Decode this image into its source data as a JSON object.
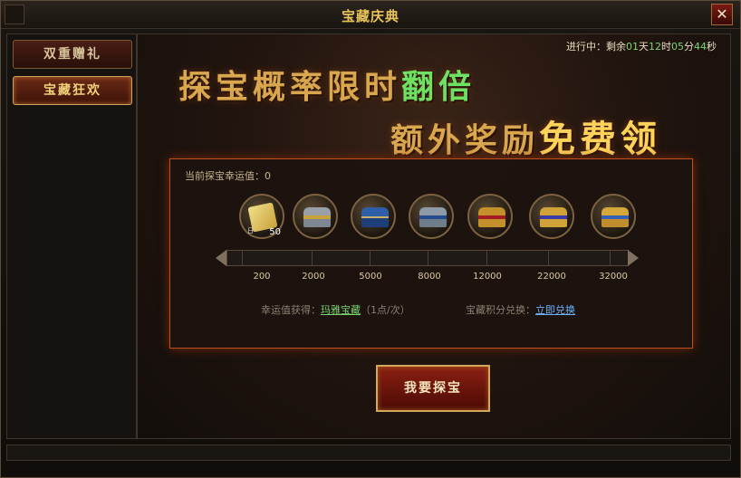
{
  "window": {
    "title": "宝藏庆典",
    "close_label": "✕"
  },
  "sidebar": {
    "tabs": [
      {
        "label": "双重赠礼",
        "active": false
      },
      {
        "label": "宝藏狂欢",
        "active": true
      }
    ]
  },
  "countdown": {
    "prefix": "进行中：剩余",
    "days": "01",
    "day_unit": "天",
    "hours": "12",
    "hour_unit": "时",
    "minutes": "05",
    "minute_unit": "分",
    "seconds": "44",
    "second_unit": "秒"
  },
  "banner": {
    "line1_prefix": "探宝概率限时",
    "line1_highlight": "翻倍",
    "line2_prefix": "额外奖励",
    "line2_highlight": "免费领"
  },
  "progress": {
    "luck_label": "当前探宝幸运值：0",
    "rewards": [
      {
        "icon": "scroll-icon",
        "quantity": "50",
        "tag": "日"
      },
      {
        "icon": "chest-icon"
      },
      {
        "icon": "chest-icon"
      },
      {
        "icon": "chest-icon"
      },
      {
        "icon": "chest-icon"
      },
      {
        "icon": "chest-icon"
      },
      {
        "icon": "chest-icon"
      }
    ],
    "milestones": [
      "200",
      "2000",
      "5000",
      "8000",
      "12000",
      "22000",
      "32000"
    ]
  },
  "info": {
    "luck_gain_label": "幸运值获得：",
    "luck_gain_link": "玛雅宝藏",
    "luck_gain_rate": "（1点/次）",
    "exchange_label": "宝藏积分兑换：",
    "exchange_link": "立即兑换"
  },
  "actions": {
    "dig_label": "我要探宝"
  }
}
